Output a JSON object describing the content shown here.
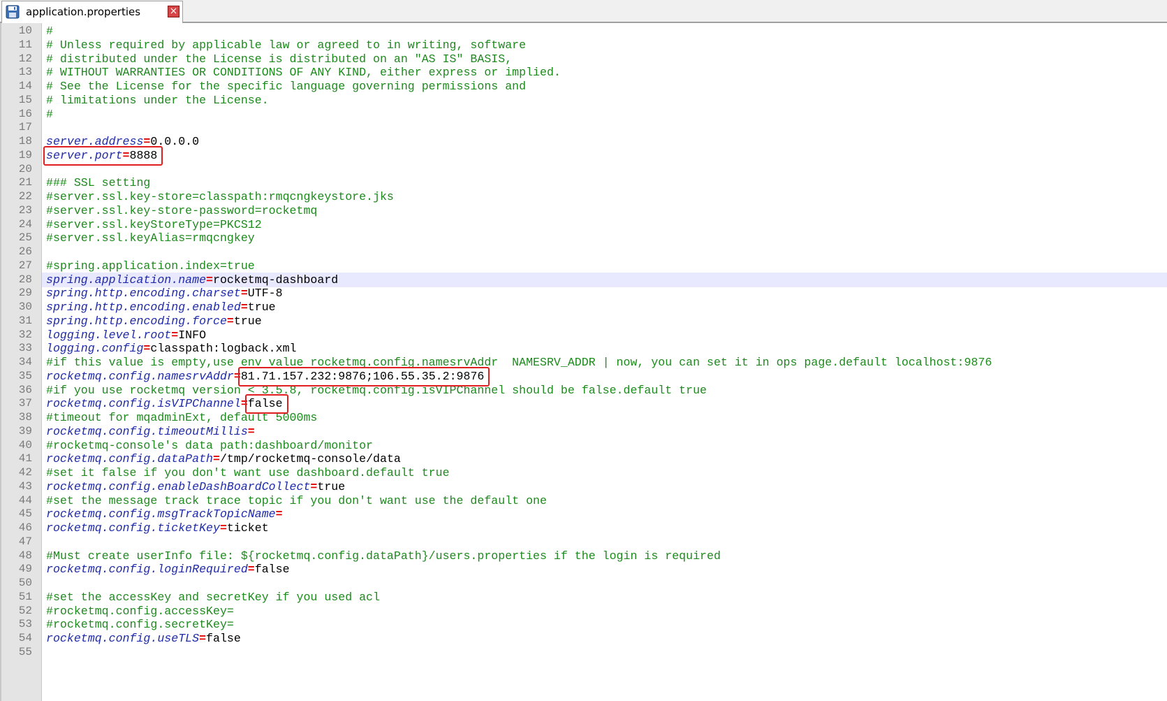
{
  "tab": {
    "title": "application.properties",
    "close_icon": "x-close-icon",
    "file_icon": "save-disk-icon"
  },
  "current_line": 28,
  "colors": {
    "comment": "#1e8a1e",
    "key": "#1f2aa8",
    "equals": "#e00000",
    "value": "#000000",
    "highlight_box": "#e02020",
    "current_line_bg": "#e8e8ff"
  },
  "lines": [
    {
      "n": "10",
      "type": "comment",
      "text": "#"
    },
    {
      "n": "11",
      "type": "comment",
      "text": "# Unless required by applicable law or agreed to in writing, software"
    },
    {
      "n": "12",
      "type": "comment",
      "text": "# distributed under the License is distributed on an \"AS IS\" BASIS,"
    },
    {
      "n": "13",
      "type": "comment",
      "text": "# WITHOUT WARRANTIES OR CONDITIONS OF ANY KIND, either express or implied."
    },
    {
      "n": "14",
      "type": "comment",
      "text": "# See the License for the specific language governing permissions and"
    },
    {
      "n": "15",
      "type": "comment",
      "text": "# limitations under the License."
    },
    {
      "n": "16",
      "type": "comment",
      "text": "#"
    },
    {
      "n": "17",
      "type": "blank",
      "text": ""
    },
    {
      "n": "18",
      "type": "prop",
      "key": "server.address",
      "value": "0.0.0.0"
    },
    {
      "n": "19",
      "type": "prop",
      "key": "server.port",
      "value": "8888"
    },
    {
      "n": "20",
      "type": "blank",
      "text": ""
    },
    {
      "n": "21",
      "type": "comment",
      "text": "### SSL setting"
    },
    {
      "n": "22",
      "type": "comment",
      "text": "#server.ssl.key-store=classpath:rmqcngkeystore.jks"
    },
    {
      "n": "23",
      "type": "comment",
      "text": "#server.ssl.key-store-password=rocketmq"
    },
    {
      "n": "24",
      "type": "comment",
      "text": "#server.ssl.keyStoreType=PKCS12"
    },
    {
      "n": "25",
      "type": "comment",
      "text": "#server.ssl.keyAlias=rmqcngkey"
    },
    {
      "n": "26",
      "type": "blank",
      "text": ""
    },
    {
      "n": "27",
      "type": "comment",
      "text": "#spring.application.index=true"
    },
    {
      "n": "28",
      "type": "prop",
      "key": "spring.application.name",
      "value": "rocketmq-dashboard"
    },
    {
      "n": "29",
      "type": "prop",
      "key": "spring.http.encoding.charset",
      "value": "UTF-8"
    },
    {
      "n": "30",
      "type": "prop",
      "key": "spring.http.encoding.enabled",
      "value": "true"
    },
    {
      "n": "31",
      "type": "prop",
      "key": "spring.http.encoding.force",
      "value": "true"
    },
    {
      "n": "32",
      "type": "prop",
      "key": "logging.level.root",
      "value": "INFO"
    },
    {
      "n": "33",
      "type": "prop",
      "key": "logging.config",
      "value": "classpath:logback.xml"
    },
    {
      "n": "34",
      "type": "comment",
      "text": "#if this value is empty,use env value rocketmq.config.namesrvAddr  NAMESRV_ADDR | now, you can set it in ops page.default localhost:9876"
    },
    {
      "n": "35",
      "type": "prop",
      "key": "rocketmq.config.namesrvAddr",
      "value": "81.71.157.232:9876;106.55.35.2:9876"
    },
    {
      "n": "36",
      "type": "comment",
      "text": "#if you use rocketmq version < 3.5.8, rocketmq.config.isVIPChannel should be false.default true"
    },
    {
      "n": "37",
      "type": "prop",
      "key": "rocketmq.config.isVIPChannel",
      "value": "false"
    },
    {
      "n": "38",
      "type": "comment",
      "text": "#timeout for mqadminExt, default 5000ms"
    },
    {
      "n": "39",
      "type": "prop",
      "key": "rocketmq.config.timeoutMillis",
      "value": ""
    },
    {
      "n": "40",
      "type": "comment",
      "text": "#rocketmq-console's data path:dashboard/monitor"
    },
    {
      "n": "41",
      "type": "prop",
      "key": "rocketmq.config.dataPath",
      "value": "/tmp/rocketmq-console/data"
    },
    {
      "n": "42",
      "type": "comment",
      "text": "#set it false if you don't want use dashboard.default true"
    },
    {
      "n": "43",
      "type": "prop",
      "key": "rocketmq.config.enableDashBoardCollect",
      "value": "true"
    },
    {
      "n": "44",
      "type": "comment",
      "text": "#set the message track trace topic if you don't want use the default one"
    },
    {
      "n": "45",
      "type": "prop",
      "key": "rocketmq.config.msgTrackTopicName",
      "value": ""
    },
    {
      "n": "46",
      "type": "prop",
      "key": "rocketmq.config.ticketKey",
      "value": "ticket"
    },
    {
      "n": "47",
      "type": "blank",
      "text": ""
    },
    {
      "n": "48",
      "type": "comment",
      "text": "#Must create userInfo file: ${rocketmq.config.dataPath}/users.properties if the login is required"
    },
    {
      "n": "49",
      "type": "prop",
      "key": "rocketmq.config.loginRequired",
      "value": "false"
    },
    {
      "n": "50",
      "type": "blank",
      "text": ""
    },
    {
      "n": "51",
      "type": "comment",
      "text": "#set the accessKey and secretKey if you used acl"
    },
    {
      "n": "52",
      "type": "comment",
      "text": "#rocketmq.config.accessKey="
    },
    {
      "n": "53",
      "type": "comment",
      "text": "#rocketmq.config.secretKey="
    },
    {
      "n": "54",
      "type": "prop",
      "key": "rocketmq.config.useTLS",
      "value": "false"
    },
    {
      "n": "55",
      "type": "blank",
      "text": ""
    }
  ],
  "highlights": [
    {
      "line": "19",
      "target": "prop"
    },
    {
      "line": "35",
      "target": "value"
    },
    {
      "line": "37",
      "target": "value"
    }
  ]
}
